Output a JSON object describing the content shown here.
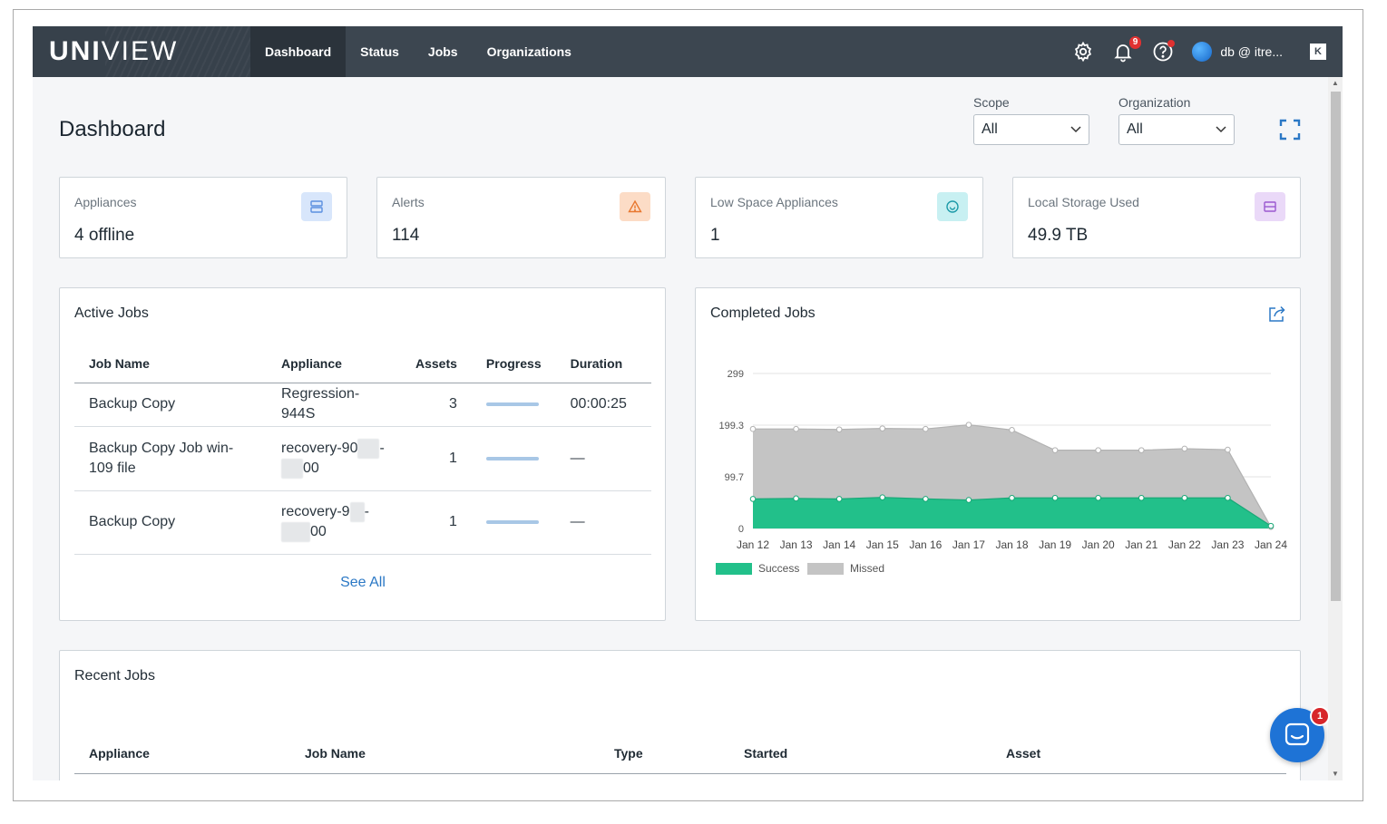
{
  "brand": {
    "logo_bold": "UNI",
    "logo_light": "VIEW"
  },
  "nav": {
    "tabs": [
      {
        "label": "Dashboard",
        "active": true
      },
      {
        "label": "Status",
        "active": false
      },
      {
        "label": "Jobs",
        "active": false
      },
      {
        "label": "Organizations",
        "active": false
      }
    ],
    "notifications_badge": "9",
    "user_name": "db      @  itre...",
    "collapse_label": "K"
  },
  "page": {
    "title": "Dashboard"
  },
  "filters": {
    "scope": {
      "label": "Scope",
      "value": "All"
    },
    "organization": {
      "label": "Organization",
      "value": "All"
    }
  },
  "stats": [
    {
      "label": "Appliances",
      "value": "4 offline",
      "icon": "server-icon",
      "color": "#5a8fe0",
      "bg": "#d8e6fb"
    },
    {
      "label": "Alerts",
      "value": "114",
      "icon": "warning-icon",
      "color": "#e8772e",
      "bg": "#fcdcc6"
    },
    {
      "label": "Low Space Appliances",
      "value": "1",
      "icon": "gauge-icon",
      "color": "#1c9aa8",
      "bg": "#c8f0f2"
    },
    {
      "label": "Local Storage Used",
      "value": "49.9 TB",
      "icon": "storage-icon",
      "color": "#9b59d0",
      "bg": "#ead9f8"
    }
  ],
  "active_jobs": {
    "title": "Active Jobs",
    "columns": [
      "Job Name",
      "Appliance",
      "Assets",
      "Progress",
      "Duration"
    ],
    "rows": [
      {
        "job_name": "Backup Copy",
        "appliance_a": "Regression-944S",
        "appliance_b": "",
        "assets": "3",
        "progress": 1.0,
        "duration": "00:00:25"
      },
      {
        "job_name": "Backup Copy Job win-109 file",
        "appliance_a": "recovery-90",
        "appliance_b": "00",
        "assets": "1",
        "progress": 1.0,
        "duration": "—"
      },
      {
        "job_name": "Backup Copy",
        "appliance_a": "recovery-9",
        "appliance_b": "00",
        "assets": "1",
        "progress": 1.0,
        "duration": "—"
      }
    ],
    "see_all": "See All"
  },
  "completed_jobs": {
    "title": "Completed Jobs",
    "chart_data": {
      "type": "area",
      "categories": [
        "Jan 12",
        "Jan 13",
        "Jan 14",
        "Jan 15",
        "Jan 16",
        "Jan 17",
        "Jan 18",
        "Jan 19",
        "Jan 20",
        "Jan 21",
        "Jan 22",
        "Jan 23",
        "Jan 24"
      ],
      "y_ticks": [
        "0",
        "99.7",
        "199.3",
        "299"
      ],
      "ylim": [
        0,
        299
      ],
      "series": [
        {
          "name": "Success",
          "color": "#22c08a",
          "values": [
            57,
            58,
            57,
            60,
            57,
            55,
            59,
            59,
            59,
            59,
            59,
            59,
            5
          ]
        },
        {
          "name": "Missed",
          "color": "#c4c4c4",
          "values": [
            192,
            192,
            191,
            193,
            192,
            200,
            190,
            151,
            151,
            151,
            154,
            152,
            3
          ]
        }
      ],
      "stacking": "total",
      "grid": true,
      "legend_position": "bottom-left"
    }
  },
  "recent_jobs": {
    "title": "Recent Jobs",
    "columns": [
      "Appliance",
      "Job Name",
      "Type",
      "Started",
      "Asset"
    ]
  },
  "chat": {
    "badge": "1"
  }
}
